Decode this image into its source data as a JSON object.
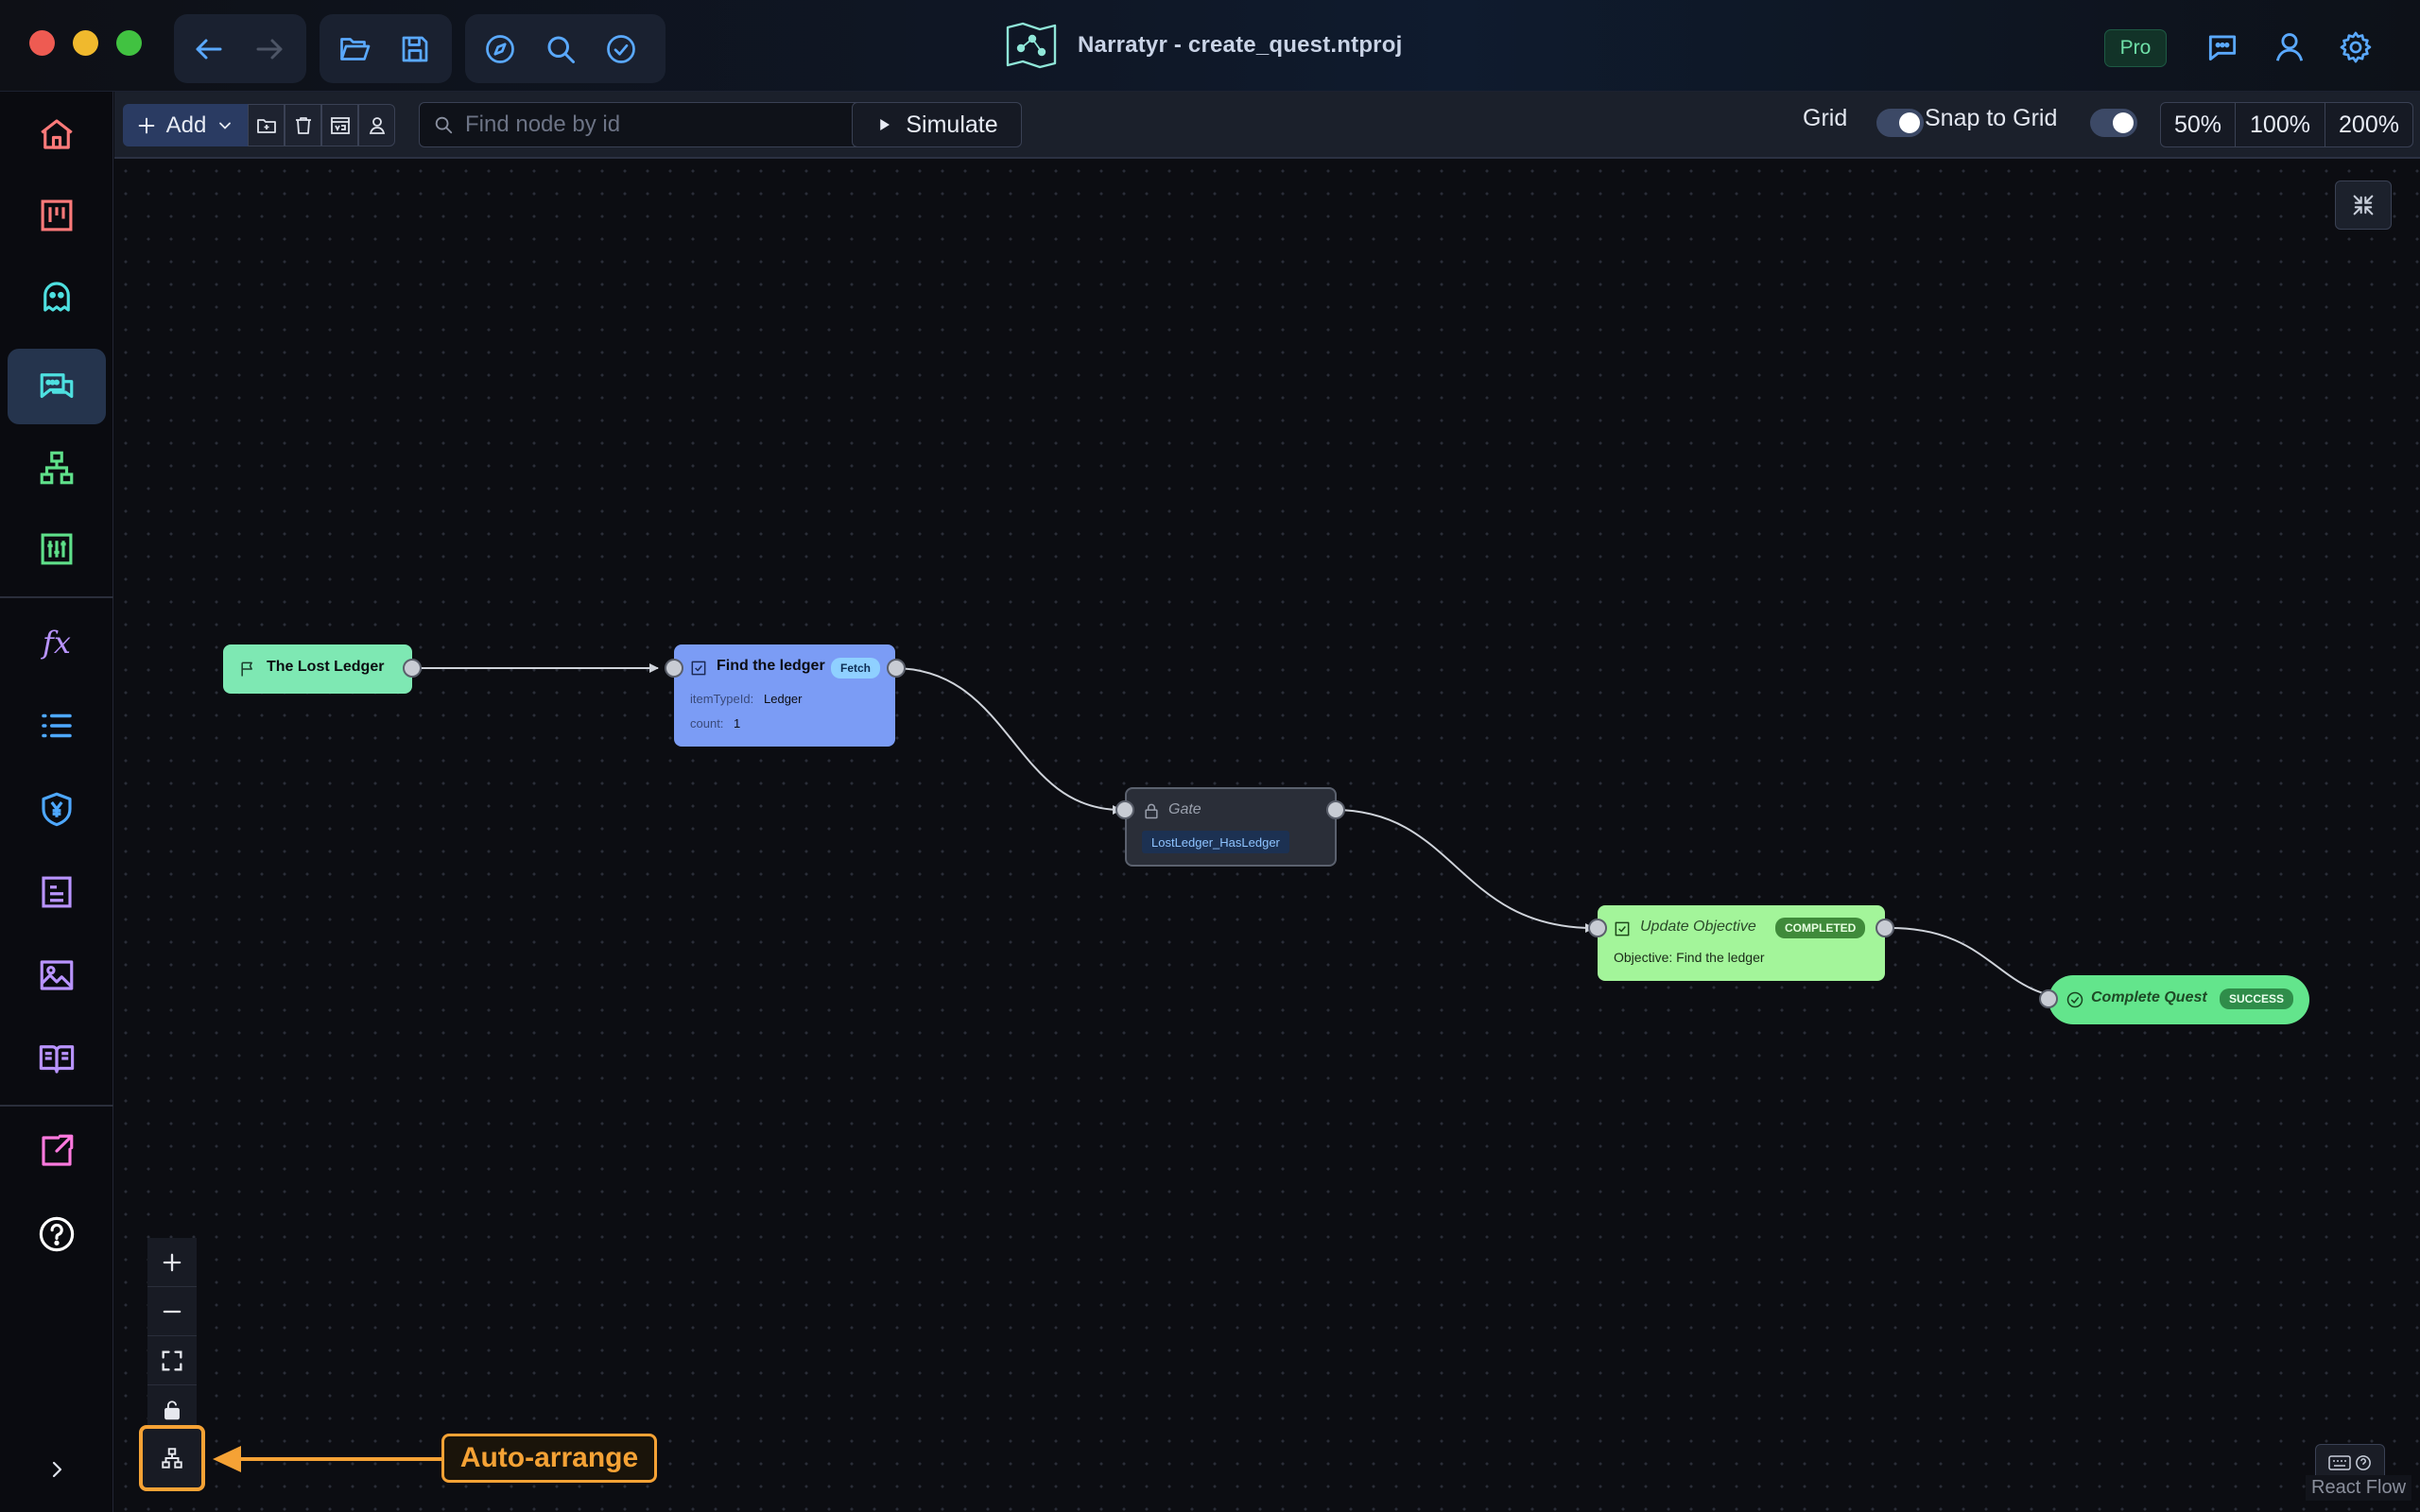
{
  "window": {
    "title": "Narratyr - create_quest.ntproj",
    "plan_badge": "Pro"
  },
  "titlebar": {
    "nav_icons": [
      "back-arrow-icon",
      "forward-arrow-icon"
    ],
    "file_icons": [
      "open-folder-icon",
      "save-icon"
    ],
    "tool_icons": [
      "compass-icon",
      "search-icon",
      "validate-check-icon"
    ],
    "right_icons": [
      "chat-icon",
      "user-icon",
      "gear-icon"
    ]
  },
  "sidebar": {
    "items": [
      {
        "name": "home",
        "icon": "home-icon",
        "color": "#ff7a7a"
      },
      {
        "name": "board",
        "icon": "kanban-icon",
        "color": "#ff7a7a"
      },
      {
        "name": "characters",
        "icon": "ghost-icon",
        "color": "#4ee0e0"
      },
      {
        "name": "dialogue",
        "icon": "chat-bubbles-icon",
        "color": "#4ee0e0",
        "active": true
      },
      {
        "name": "quest-graph",
        "icon": "hierarchy-icon",
        "color": "#5fe08a"
      },
      {
        "name": "variables",
        "icon": "sliders-icon",
        "color": "#5fe08a"
      },
      {
        "name": "functions",
        "icon": "fx-icon",
        "label": "fx",
        "color": "#b994ff"
      },
      {
        "name": "lists",
        "icon": "list-icon",
        "color": "#4ea8ff"
      },
      {
        "name": "economy",
        "icon": "yen-shield-icon",
        "color": "#4ea8ff"
      },
      {
        "name": "ui-screens",
        "icon": "screen-icon",
        "color": "#b994ff"
      },
      {
        "name": "assets",
        "icon": "image-icon",
        "color": "#b994ff"
      },
      {
        "name": "localization",
        "icon": "book-icon",
        "color": "#b994ff"
      },
      {
        "name": "export",
        "icon": "export-icon",
        "color": "#ff7adf"
      },
      {
        "name": "help",
        "icon": "help-icon",
        "color": "#ffffff"
      }
    ]
  },
  "toolbar": {
    "add_label": "Add",
    "search": {
      "placeholder": "Find node by id",
      "value": ""
    },
    "simulate_label": "Simulate",
    "grid_label": "Grid",
    "grid_on": true,
    "snap_label": "Snap to Grid",
    "snap_on": true,
    "zoom_levels": [
      "50%",
      "100%",
      "200%"
    ]
  },
  "graph": {
    "nodes": {
      "start": {
        "title": "The Lost Ledger",
        "icon": "flag-icon",
        "color": "#7ee8b3"
      },
      "fetch": {
        "title": "Find the ledger",
        "badge": "Fetch",
        "icon": "checkbox-icon",
        "field1_key": "itemTypeId:",
        "field1_val": "Ledger",
        "field2_key": "count:",
        "field2_val": "1",
        "color": "#7b9cf5"
      },
      "gate": {
        "title": "Gate",
        "condition": "LostLedger_HasLedger",
        "icon": "lock-icon",
        "color": "#2a2e38"
      },
      "update": {
        "title": "Update Objective",
        "badge": "COMPLETED",
        "icon": "checkbox-icon",
        "detail": "Objective: Find the ledger",
        "color": "#a3f59a"
      },
      "complete": {
        "title": "Complete Quest",
        "badge": "SUCCESS",
        "icon": "check-circle-icon",
        "color": "#63e58c"
      }
    }
  },
  "canvas_controls": [
    "zoom-in-icon",
    "zoom-out-icon",
    "fit-view-icon",
    "lock-icon",
    "auto-arrange-icon"
  ],
  "callout": {
    "label": "Auto-arrange",
    "color": "#f5a235"
  },
  "attribution": "React Flow"
}
